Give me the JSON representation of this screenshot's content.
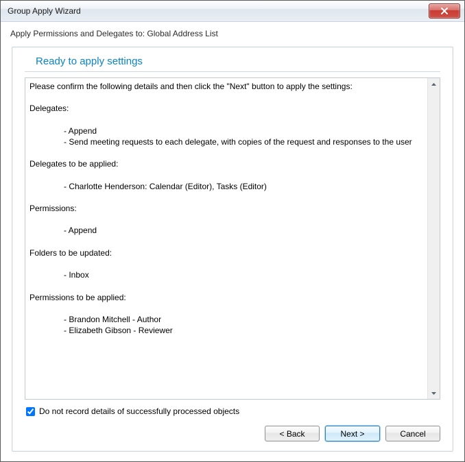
{
  "window": {
    "title": "Group Apply Wizard"
  },
  "subtitle": "Apply Permissions and Delegates to: Global Address List",
  "section": {
    "heading": "Ready to apply settings"
  },
  "summary": {
    "intro": "Please confirm the following details and then click the \"Next\" button to apply the settings:",
    "delegates_header": "Delegates:",
    "delegates_lines": [
      "- Append",
      "- Send meeting requests to each delegate, with copies of the request and responses to the user"
    ],
    "delegates_to_apply_header": "Delegates to be applied:",
    "delegates_to_apply": [
      "- Charlotte Henderson: Calendar (Editor), Tasks (Editor)"
    ],
    "permissions_header": "Permissions:",
    "permissions_lines": [
      "- Append"
    ],
    "folders_header": "Folders to be updated:",
    "folders_lines": [
      "- Inbox"
    ],
    "permissions_to_apply_header": "Permissions to be applied:",
    "permissions_to_apply": [
      "- Brandon Mitchell - Author",
      "- Elizabeth Gibson - Reviewer"
    ]
  },
  "checkbox": {
    "checked": true,
    "label": "Do not record details of successfully processed objects"
  },
  "buttons": {
    "back": "< Back",
    "next": "Next >",
    "cancel": "Cancel"
  }
}
